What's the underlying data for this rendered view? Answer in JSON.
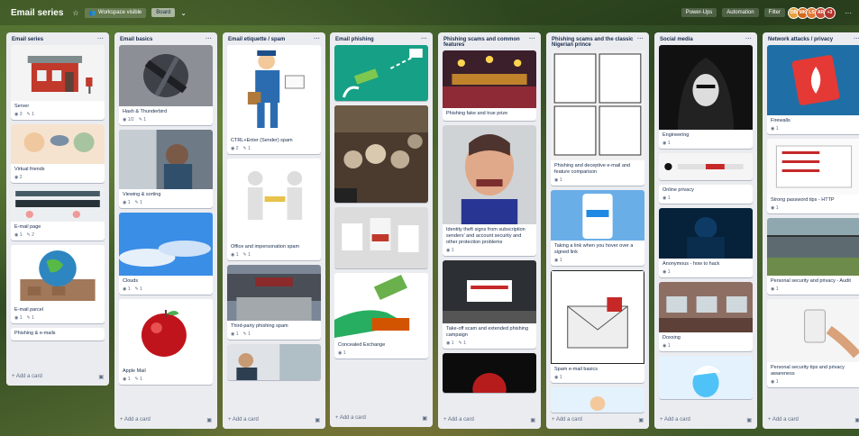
{
  "board": {
    "name": "Email series",
    "star_icon": "star-icon",
    "workspace_label": "Workspace visible",
    "view_label": "Board",
    "menu": [
      "Power-Ups",
      "Automation",
      "Filter"
    ],
    "avatars": [
      "DB",
      "MK",
      "LS",
      "AR",
      "+3"
    ]
  },
  "lists": [
    {
      "title": "Email series",
      "add_label": "+ Add a card",
      "cards": [
        {
          "title": "Server",
          "badges": [
            "3",
            "1"
          ],
          "cover": "post-office"
        },
        {
          "title": "Virtual friends",
          "badges": [
            "2"
          ],
          "cover": "heads"
        },
        {
          "title": "E-mail page",
          "badges": [
            "1",
            "2"
          ],
          "cover": "ui"
        },
        {
          "title": "E-mail parcel",
          "badges": [
            "1",
            "1"
          ],
          "cover": "globe"
        },
        {
          "title": "Phishing & e-mails",
          "badges": [],
          "cover": ""
        }
      ]
    },
    {
      "title": "Email basics",
      "add_label": "+ Add a card",
      "cards": [
        {
          "title": "Hash & Thunderbird",
          "badges": [
            "1/2",
            "1"
          ],
          "cover": "storm"
        },
        {
          "title": "Viewing & sorting",
          "badges": [
            "1",
            "1"
          ],
          "cover": "window"
        },
        {
          "title": "Clouds",
          "badges": [
            "1",
            "1"
          ],
          "cover": "sky"
        },
        {
          "title": "Apple Mail",
          "badges": [
            "1",
            "1"
          ],
          "cover": "apple"
        }
      ]
    },
    {
      "title": "Email etiquette / spam",
      "add_label": "+ Add a card",
      "cards": [
        {
          "title": "CTRL+Enter (Sender) spam",
          "badges": [
            "2",
            "1"
          ],
          "cover": "mailman"
        },
        {
          "title": "Office and impersonation spam",
          "badges": [
            "1",
            "1"
          ],
          "cover": "figures"
        },
        {
          "title": "Third-party phishing spam",
          "badges": [
            "1",
            "1"
          ],
          "cover": "street"
        },
        {
          "title": "",
          "badges": [],
          "cover": "person"
        }
      ]
    },
    {
      "title": "Email phishing",
      "add_label": "+ Add a card",
      "cards": [
        {
          "title": "",
          "badges": [],
          "cover": "money-hand"
        },
        {
          "title": "",
          "badges": [],
          "cover": "crowd"
        },
        {
          "title": "",
          "badges": [],
          "cover": "cups"
        },
        {
          "title": "Concealed Exchange",
          "badges": [
            "1"
          ],
          "cover": "cash"
        }
      ]
    },
    {
      "title": "Phishing scams and common features",
      "add_label": "+ Add a card",
      "cards": [
        {
          "title": "Phishing fake and true prize",
          "badges": [],
          "cover": "casino"
        },
        {
          "title": "Identity theft signs from subscription senders' and account security and other protection problems",
          "badges": [
            "1"
          ],
          "cover": "angry"
        },
        {
          "title": "Take-off scam and extended phishing campaign",
          "badges": [
            "1",
            "1"
          ],
          "cover": "ban"
        },
        {
          "title": "",
          "badges": [],
          "cover": "dark"
        }
      ]
    },
    {
      "title": "Phishing scams and the classic Nigerian prince",
      "add_label": "+ Add a card",
      "cards": [
        {
          "title": "Phishing and deceptive e-mail and feature comparison",
          "badges": [
            "1"
          ],
          "cover": "comic"
        },
        {
          "title": "Taking a link when you hover over a signed link",
          "badges": [
            "1"
          ],
          "cover": "phone"
        },
        {
          "title": "Spam e-mail basics",
          "badges": [
            "1"
          ],
          "cover": "poster"
        },
        {
          "title": "",
          "badges": [],
          "cover": "small"
        }
      ]
    },
    {
      "title": "Social media",
      "add_label": "+ Add a card",
      "cards": [
        {
          "title": "Engineering",
          "badges": [
            "1"
          ],
          "cover": "hoodie"
        },
        {
          "title": "",
          "badges": [],
          "cover": "strip"
        },
        {
          "title": "Online privacy",
          "badges": [
            "1"
          ],
          "cover": ""
        },
        {
          "title": "Anonymous - how to hack",
          "badges": [
            "1"
          ],
          "cover": "hacker"
        },
        {
          "title": "Doxxing",
          "badges": [
            "1"
          ],
          "cover": "office"
        },
        {
          "title": "",
          "badges": [],
          "cover": "smurf"
        }
      ]
    },
    {
      "title": "Network attacks / privacy",
      "add_label": "+ Add a card",
      "cards": [
        {
          "title": "Firewalls",
          "badges": [
            "1"
          ],
          "cover": "firewall"
        },
        {
          "title": "Strong password tips - HTTP",
          "badges": [
            "1"
          ],
          "cover": "checklist"
        },
        {
          "title": "Personal security and privacy - Audit",
          "badges": [
            "1"
          ],
          "cover": "bridge"
        },
        {
          "title": "Personal security tips and privacy awareness",
          "badges": [
            "1"
          ],
          "cover": "switch"
        }
      ]
    }
  ]
}
